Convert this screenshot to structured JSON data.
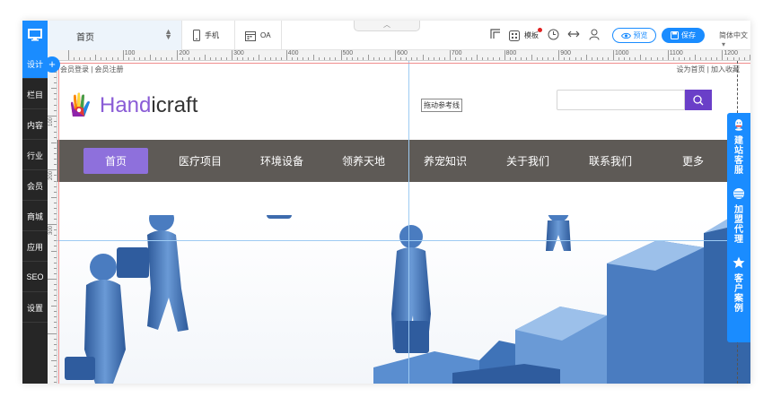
{
  "sidebar": {
    "items": [
      "设计",
      "栏目",
      "内容",
      "行业",
      "会员",
      "商城",
      "应用",
      "SEO",
      "设置"
    ]
  },
  "toolbar": {
    "page_select": "首页",
    "mobile_label": "手机",
    "oa_label": "OA",
    "template_label": "模板",
    "preview_label": "预览",
    "save_label": "保存",
    "language": "简体中文"
  },
  "ruler": {
    "marks": [
      "100",
      "200",
      "300",
      "400",
      "500",
      "600",
      "700",
      "800",
      "900",
      "1000",
      "1100",
      "1200"
    ],
    "left_marks": [
      "100",
      "200",
      "300"
    ]
  },
  "site": {
    "top_left": "会员登录 | 会员注册",
    "top_right": "设为首页 | 加入收藏",
    "logo": {
      "part1": "Hand",
      "part2": "icraft"
    },
    "guide_label": "拖动参考线",
    "nav": [
      "首页",
      "医疗项目",
      "环境设备",
      "领养天地",
      "养宠知识",
      "关于我们",
      "联系我们",
      "更多"
    ]
  },
  "float": {
    "items": [
      "建站客服",
      "加盟代理",
      "客户案例"
    ]
  },
  "colors": {
    "accent": "#1a8cff",
    "nav_bg": "#5e5a56",
    "nav_active": "#8e70dc",
    "search_btn": "#6a3fc8"
  }
}
